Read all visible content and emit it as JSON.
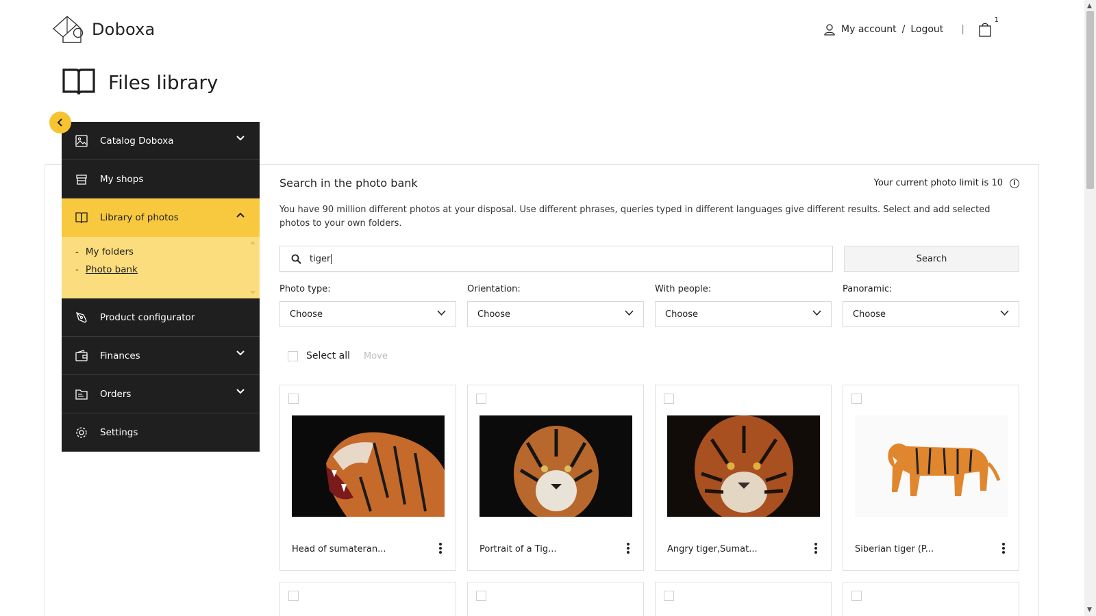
{
  "brand": {
    "name": "Doboxa"
  },
  "topnav": {
    "account": "My account",
    "separator": "/",
    "logout": "Logout",
    "cart_count": "1"
  },
  "page": {
    "title": "Files library"
  },
  "sidebar": {
    "items": [
      {
        "label": "Catalog Doboxa",
        "icon": "image-icon"
      },
      {
        "label": "My shops",
        "icon": "shop-icon"
      },
      {
        "label": "Library of photos",
        "icon": "book-icon"
      },
      {
        "label": "Product configurator",
        "icon": "pen-tool-icon"
      },
      {
        "label": "Finances",
        "icon": "wallet-icon"
      },
      {
        "label": "Orders",
        "icon": "folder-icon"
      },
      {
        "label": "Settings",
        "icon": "gear-icon"
      }
    ],
    "submenu": [
      {
        "label": "My folders"
      },
      {
        "label": "Photo bank"
      }
    ]
  },
  "main": {
    "title": "Search in the photo bank",
    "limit_text": "Your current photo limit is 10",
    "description": "You have 90 million different photos at your disposal. Use different phrases, queries typed in different languages give different results. Select and add selected photos to your own folders.",
    "search_value": "tiger",
    "search_button": "Search",
    "filters": [
      {
        "label": "Photo type:",
        "value": "Choose"
      },
      {
        "label": "Orientation:",
        "value": "Choose"
      },
      {
        "label": "With people:",
        "value": "Choose"
      },
      {
        "label": "Panoramic:",
        "value": "Choose"
      }
    ],
    "select_all": "Select all",
    "move": "Move",
    "photos": [
      {
        "name": "Head of sumateran..."
      },
      {
        "name": "Portrait of a Tig..."
      },
      {
        "name": "Angry tiger,Sumat..."
      },
      {
        "name": "Siberian tiger (P..."
      }
    ]
  },
  "colors": {
    "accent": "#f8c93e",
    "submenu": "#fcdd7d",
    "sidebar_dark": "#1f1f1f"
  }
}
